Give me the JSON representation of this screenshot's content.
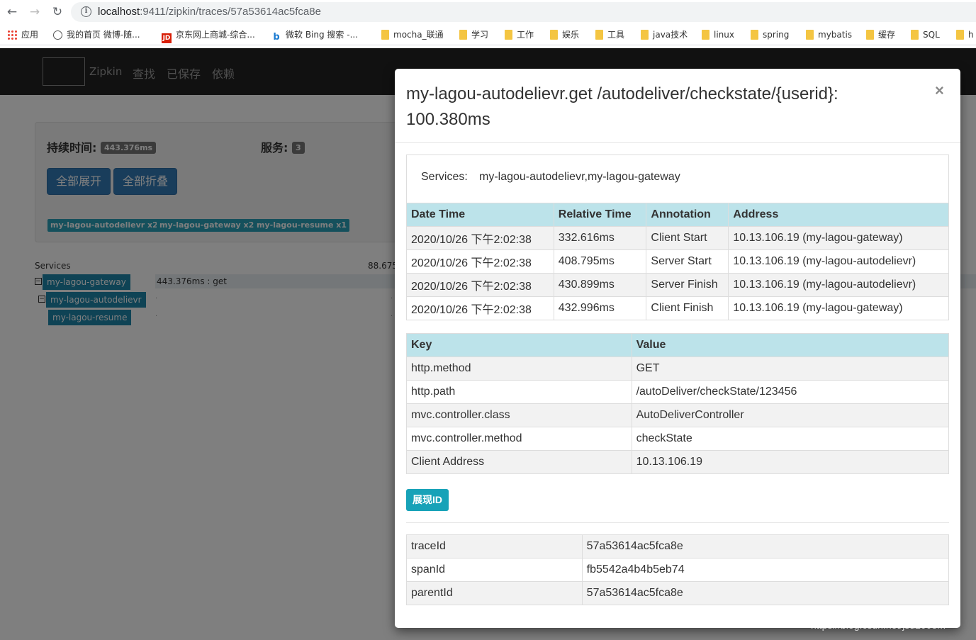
{
  "browser": {
    "url_host": "localhost",
    "url_rest": ":9411/zipkin/traces/57a53614ac5fca8e",
    "bookmarks": [
      "应用",
      "我的首页 微博-随...",
      "京东网上商城-综合...",
      "微软 Bing 搜索 -...",
      "mocha_联通",
      "学习",
      "工作",
      "娱乐",
      "工具",
      "java技术",
      "linux",
      "spring",
      "mybatis",
      "缓存",
      "SQL",
      "h"
    ],
    "jd_logo": "JD",
    "bing_logo": "b"
  },
  "zipkin": {
    "brand": "Zipkin",
    "nav": [
      "查找",
      "已保存",
      "依赖"
    ],
    "duration_label": "持续时间:",
    "duration_value": "443.376ms",
    "services_label": "服务:",
    "services_count": "3",
    "expand_all": "全部展开",
    "collapse_all": "全部折叠",
    "service_tags": [
      "my-lagou-autodelievr x2",
      "my-lagou-gateway x2",
      "my-lagou-resume x1"
    ],
    "tree_header": "Services",
    "tree_time": "88.675",
    "tree": [
      {
        "service": "my-lagou-gateway",
        "span": "443.376ms : get",
        "expander": "−"
      },
      {
        "service": "my-lagou-autodelievr",
        "span": "",
        "expander": "−"
      },
      {
        "service": "my-lagou-resume",
        "span": "",
        "expander": ""
      }
    ]
  },
  "modal": {
    "title": "my-lagou-autodelievr.get /autodeliver/checkstate/{userid}: 100.380ms",
    "close": "×",
    "services_label": "Services:",
    "services_value": "my-lagou-autodelievr,my-lagou-gateway",
    "annotations": {
      "headers": [
        "Date Time",
        "Relative Time",
        "Annotation",
        "Address"
      ],
      "rows": [
        [
          "2020/10/26 下午2:02:38",
          "332.616ms",
          "Client Start",
          "10.13.106.19 (my-lagou-gateway)"
        ],
        [
          "2020/10/26 下午2:02:38",
          "408.795ms",
          "Server Start",
          "10.13.106.19 (my-lagou-autodelievr)"
        ],
        [
          "2020/10/26 下午2:02:38",
          "430.899ms",
          "Server Finish",
          "10.13.106.19 (my-lagou-autodelievr)"
        ],
        [
          "2020/10/26 下午2:02:38",
          "432.996ms",
          "Client Finish",
          "10.13.106.19 (my-lagou-gateway)"
        ]
      ]
    },
    "tags": {
      "headers": [
        "Key",
        "Value"
      ],
      "rows": [
        [
          "http.method",
          "GET"
        ],
        [
          "http.path",
          "/autoDeliver/checkState/123456"
        ],
        [
          "mvc.controller.class",
          "AutoDeliverController"
        ],
        [
          "mvc.controller.method",
          "checkState"
        ],
        [
          "Client Address",
          "10.13.106.19"
        ]
      ]
    },
    "show_ids_button": "展现ID",
    "ids": [
      [
        "traceId",
        "57a53614ac5fca8e"
      ],
      [
        "spanId",
        "fb5542a4b4b5eb74"
      ],
      [
        "parentId",
        "57a53614ac5fca8e"
      ]
    ]
  },
  "watermark": "https://blog.csdn.net/jsd2008m"
}
